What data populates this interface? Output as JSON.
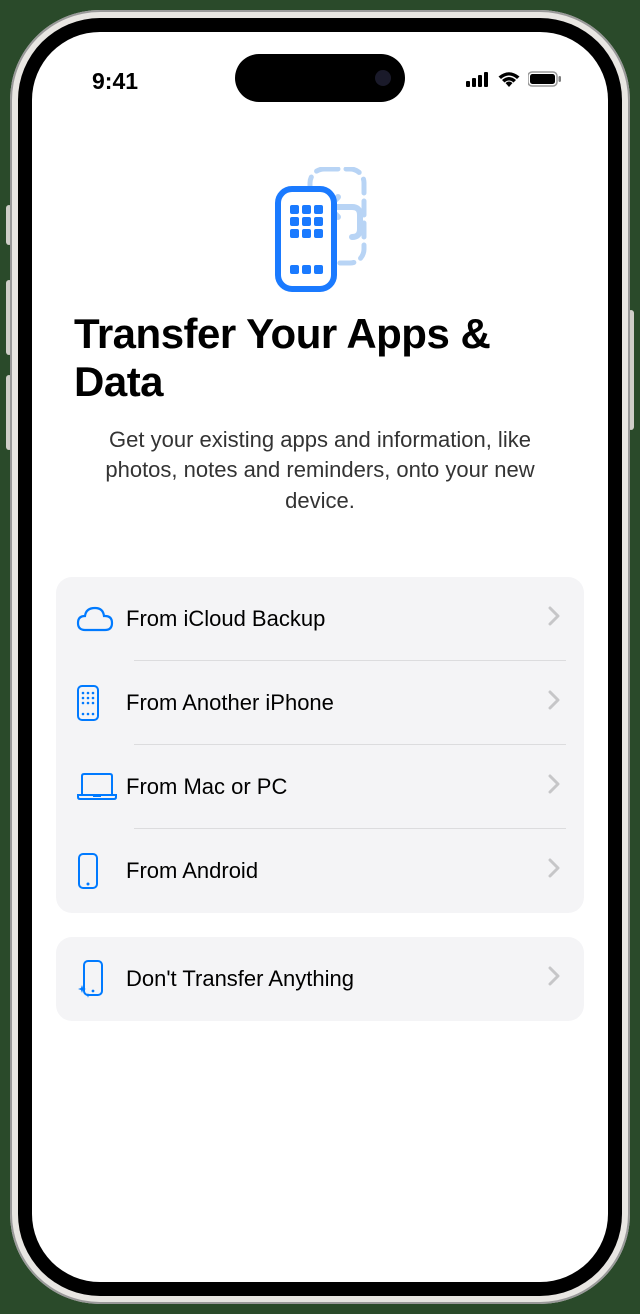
{
  "status": {
    "time": "9:41"
  },
  "hero": {
    "title": "Transfer Your Apps & Data",
    "subtitle": "Get your existing apps and information, like photos, notes and reminders, onto your new device."
  },
  "options": {
    "icloud": "From iCloud Backup",
    "iphone": "From Another iPhone",
    "mac": "From Mac or PC",
    "android": "From Android",
    "none": "Don't Transfer Anything"
  }
}
